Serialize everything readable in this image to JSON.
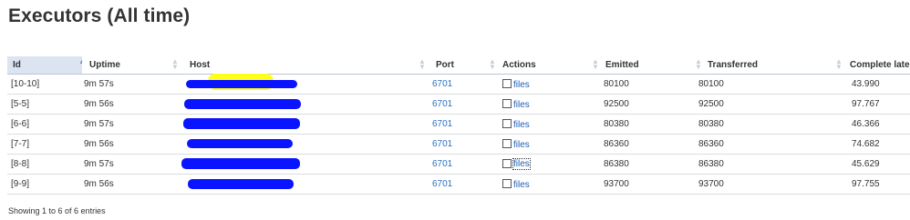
{
  "page_title": "Executors (All time)",
  "columns": {
    "id": "Id",
    "uptime": "Uptime",
    "host": "Host",
    "port": "Port",
    "actions": "Actions",
    "emitted": "Emitted",
    "transferred": "Transferred",
    "complete_latency": "Complete laten"
  },
  "sort": {
    "column": "Id",
    "direction": "ascending",
    "indicator_color": "#6f8fd0"
  },
  "rows": [
    {
      "id": "[10-10]",
      "uptime": "9m 57s",
      "port": "6701",
      "action": "files",
      "emitted": "80100",
      "transferred": "80100",
      "latency": "43.990"
    },
    {
      "id": "[5-5]",
      "uptime": "9m 56s",
      "port": "6701",
      "action": "files",
      "emitted": "92500",
      "transferred": "92500",
      "latency": "97.767"
    },
    {
      "id": "[6-6]",
      "uptime": "9m 57s",
      "port": "6701",
      "action": "files",
      "emitted": "80380",
      "transferred": "80380",
      "latency": "46.366"
    },
    {
      "id": "[7-7]",
      "uptime": "9m 56s",
      "port": "6701",
      "action": "files",
      "emitted": "86360",
      "transferred": "86360",
      "latency": "74.682"
    },
    {
      "id": "[8-8]",
      "uptime": "9m 57s",
      "port": "6701",
      "action": "files",
      "emitted": "86380",
      "transferred": "86380",
      "latency": "45.629"
    },
    {
      "id": "[9-9]",
      "uptime": "9m 56s",
      "port": "6701",
      "action": "files",
      "emitted": "93700",
      "transferred": "93700",
      "latency": "97.755"
    }
  ],
  "footer": {
    "info": "Showing 1 to 6 of 6 entries"
  },
  "colors": {
    "link": "#2a6fbf",
    "redaction": "#0a14ff",
    "highlight": "#ffff19",
    "header_sorted_bg": "#dde4f1"
  }
}
